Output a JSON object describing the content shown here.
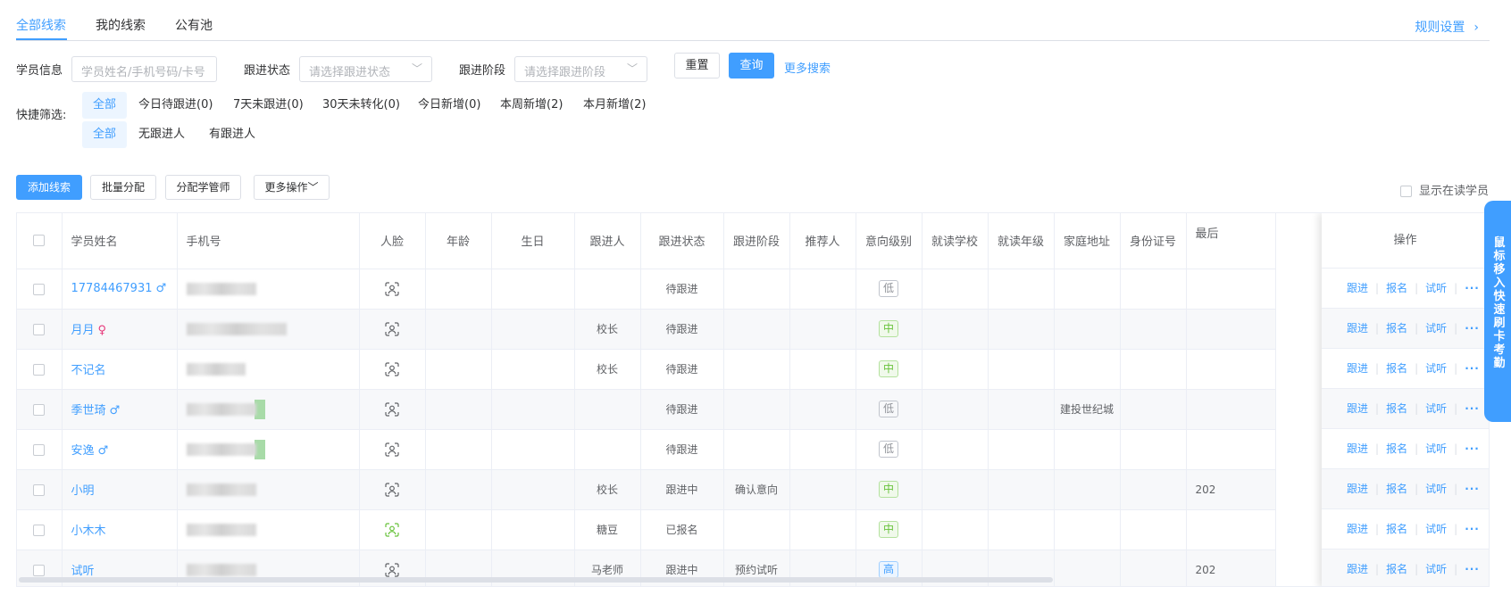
{
  "tabs": [
    {
      "label": "全部线索"
    },
    {
      "label": "我的线索"
    },
    {
      "label": "公有池"
    }
  ],
  "rules_link": "规则设置",
  "filters": {
    "student_info_label": "学员信息",
    "student_info_placeholder": "学员姓名/手机号码/卡号",
    "follow_status_label": "跟进状态",
    "follow_status_placeholder": "请选择跟进状态",
    "follow_stage_label": "跟进阶段",
    "follow_stage_placeholder": "请选择跟进阶段",
    "reset_label": "重置",
    "query_label": "查询",
    "more_search_label": "更多搜索"
  },
  "quick_filter": {
    "label": "快捷筛选:",
    "row1": [
      "全部",
      "今日待跟进(0)",
      "7天未跟进(0)",
      "30天未转化(0)",
      "今日新增(0)",
      "本周新增(2)",
      "本月新增(2)"
    ],
    "row2": [
      "全部",
      "无跟进人",
      "有跟进人"
    ]
  },
  "actions": {
    "add_lead": "添加线索",
    "batch_assign": "批量分配",
    "assign_manager": "分配学管师",
    "more_ops": "更多操作",
    "show_reading": "显示在读学员"
  },
  "table": {
    "headers": {
      "name": "学员姓名",
      "phone": "手机号",
      "face": "人脸",
      "age": "年龄",
      "birthday": "生日",
      "follower": "跟进人",
      "status": "跟进状态",
      "stage": "跟进阶段",
      "referrer": "推荐人",
      "intent": "意向级别",
      "school": "就读学校",
      "grade": "就读年级",
      "address": "家庭地址",
      "id_card": "身份证号",
      "last": "最后",
      "ops": "操作"
    },
    "rows": [
      {
        "name": "17784467931",
        "gender": "male",
        "follower": "",
        "status": "待跟进",
        "stage": "",
        "intent": "低",
        "intent_level": "low",
        "address": "",
        "last": "",
        "face_color": "#606266"
      },
      {
        "name": "月月",
        "gender": "female",
        "follower": "校长",
        "status": "待跟进",
        "stage": "",
        "intent": "中",
        "intent_level": "mid",
        "address": "",
        "last": "",
        "face_color": "#606266"
      },
      {
        "name": "不记名",
        "gender": "",
        "follower": "校长",
        "status": "待跟进",
        "stage": "",
        "intent": "中",
        "intent_level": "mid",
        "address": "",
        "last": "",
        "face_color": "#606266"
      },
      {
        "name": "季世琦",
        "gender": "male",
        "follower": "",
        "status": "待跟进",
        "stage": "",
        "intent": "低",
        "intent_level": "low",
        "address": "建投世纪城",
        "last": "",
        "face_color": "#606266"
      },
      {
        "name": "安逸",
        "gender": "male",
        "follower": "",
        "status": "待跟进",
        "stage": "",
        "intent": "低",
        "intent_level": "low",
        "address": "",
        "last": "",
        "face_color": "#606266"
      },
      {
        "name": "小明",
        "gender": "",
        "follower": "校长",
        "status": "跟进中",
        "stage": "确认意向",
        "intent": "中",
        "intent_level": "mid",
        "address": "",
        "last": "202",
        "face_color": "#606266"
      },
      {
        "name": "小木木",
        "gender": "",
        "follower": "糖豆",
        "status": "已报名",
        "stage": "",
        "intent": "中",
        "intent_level": "mid",
        "address": "",
        "last": "",
        "face_color": "#67c23a"
      },
      {
        "name": "试听",
        "gender": "",
        "follower": "马老师",
        "status": "跟进中",
        "stage": "预约试听",
        "intent": "高",
        "intent_level": "high",
        "address": "",
        "last": "202",
        "face_color": "#606266"
      }
    ],
    "ops": {
      "follow": "跟进",
      "enroll": "报名",
      "trial": "试听",
      "more": "···"
    }
  },
  "side_tab": "鼠标移入 快速刷卡考勤",
  "colors": {
    "primary": "#409eff",
    "male": "#409eff",
    "female": "#e6387a",
    "mid": "#67c23a"
  }
}
